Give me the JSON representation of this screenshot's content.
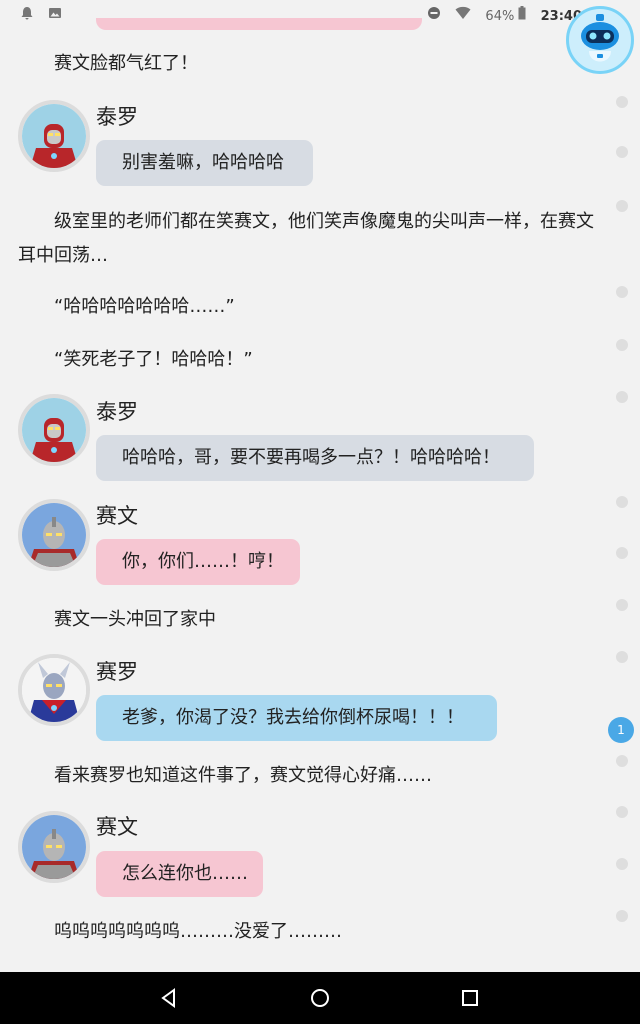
{
  "status_bar": {
    "battery": "64%",
    "time": "23:40",
    "left_icons": [
      "notification-bell-icon",
      "image-icon"
    ],
    "right_icons": [
      "do-not-disturb-icon",
      "wifi-icon",
      "battery-icon"
    ]
  },
  "colors": {
    "background": "#f2f2f2",
    "bubble_gray": "#d7dce3",
    "bubble_pink": "#f6c6d2",
    "bubble_blue": "#a9d8f0",
    "active_dot": "#4aa8e6"
  },
  "story": [
    {
      "type": "narration",
      "text": "赛文脸都气红了！"
    },
    {
      "type": "dialogue",
      "speaker": "泰罗",
      "avatar": "taro-avatar",
      "style": "gray",
      "text": "别害羞嘛，哈哈哈哈"
    },
    {
      "type": "narration",
      "text": "级室里的老师们都在笑赛文，他们笑声像魔鬼的尖叫声一样，在赛文耳中回荡…"
    },
    {
      "type": "narration",
      "text": "“哈哈哈哈哈哈哈……”"
    },
    {
      "type": "narration",
      "text": "“笑死老子了！哈哈哈！”"
    },
    {
      "type": "dialogue",
      "speaker": "泰罗",
      "avatar": "taro-avatar",
      "style": "gray",
      "text": "哈哈哈，哥，要不要再喝多一点？！哈哈哈哈！"
    },
    {
      "type": "dialogue",
      "speaker": "赛文",
      "avatar": "seven-avatar",
      "style": "pink",
      "text": "你，你们……！哼！"
    },
    {
      "type": "narration",
      "text": "赛文一头冲回了家中"
    },
    {
      "type": "dialogue",
      "speaker": "赛罗",
      "avatar": "zero-avatar",
      "style": "blue",
      "text": "老爹，你渴了没？我去给你倒杯尿喝！！！"
    },
    {
      "type": "narration",
      "text": "看来赛罗也知道这件事了，赛文觉得心好痛……"
    },
    {
      "type": "dialogue",
      "speaker": "赛文",
      "avatar": "seven-avatar",
      "style": "pink",
      "text": "怎么连你也……"
    },
    {
      "type": "narration",
      "text": "呜呜呜呜呜呜呜………没爱了………"
    }
  ],
  "scroll_indicator": {
    "active_label": "1"
  },
  "nav_bar": {
    "icons": [
      "back-icon",
      "home-icon",
      "recents-icon"
    ]
  }
}
